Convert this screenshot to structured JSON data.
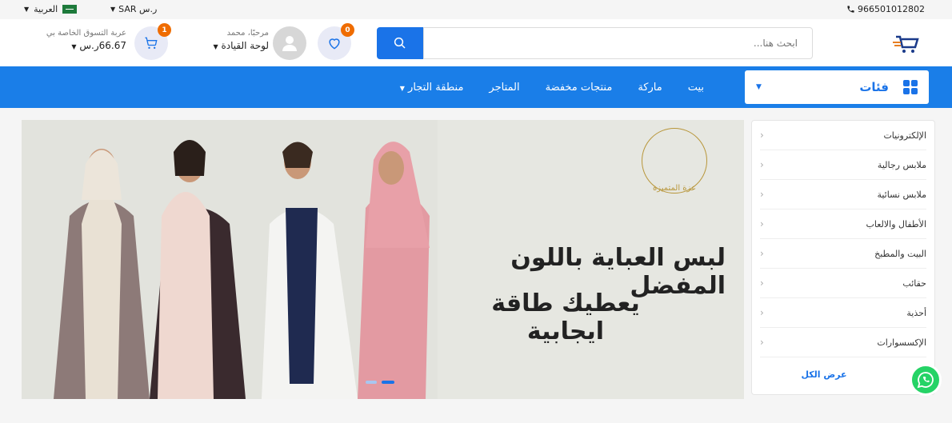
{
  "topbar": {
    "phone": "966501012802",
    "currency": "SAR ر.س",
    "language": "العربية"
  },
  "header": {
    "search_placeholder": "ابحث هنا...",
    "wishlist_count": "0",
    "greeting": "مرحبًا، محمد",
    "dashboard_label": "لوحة القيادة",
    "cart_count": "1",
    "cart_title": "عربة التسوق الخاصة بي",
    "cart_total": "66.67ر.س"
  },
  "nav": {
    "categories_label": "فئات",
    "links": [
      "بيت",
      "ماركة",
      "منتجات مخفضة",
      "المتاجر",
      "منطقة التجار"
    ]
  },
  "banner": {
    "brand_name": "عزة المتميزة",
    "headline_line1": "لبس العباية باللون المفضل",
    "headline_line2": "يعطيك طاقة ايجابية"
  },
  "sidebar": {
    "items": [
      "الإلكترونيات",
      "ملابس رجالية",
      "ملابس نسائية",
      "الأطفال والالعاب",
      "البيت والمطبخ",
      "حقائب",
      "أحذية",
      "الإكسسوارات"
    ],
    "view_all": "عرض الكل"
  },
  "colors": {
    "primary": "#1a7ee8",
    "badge": "#ef6c00",
    "whatsapp": "#25d366"
  }
}
